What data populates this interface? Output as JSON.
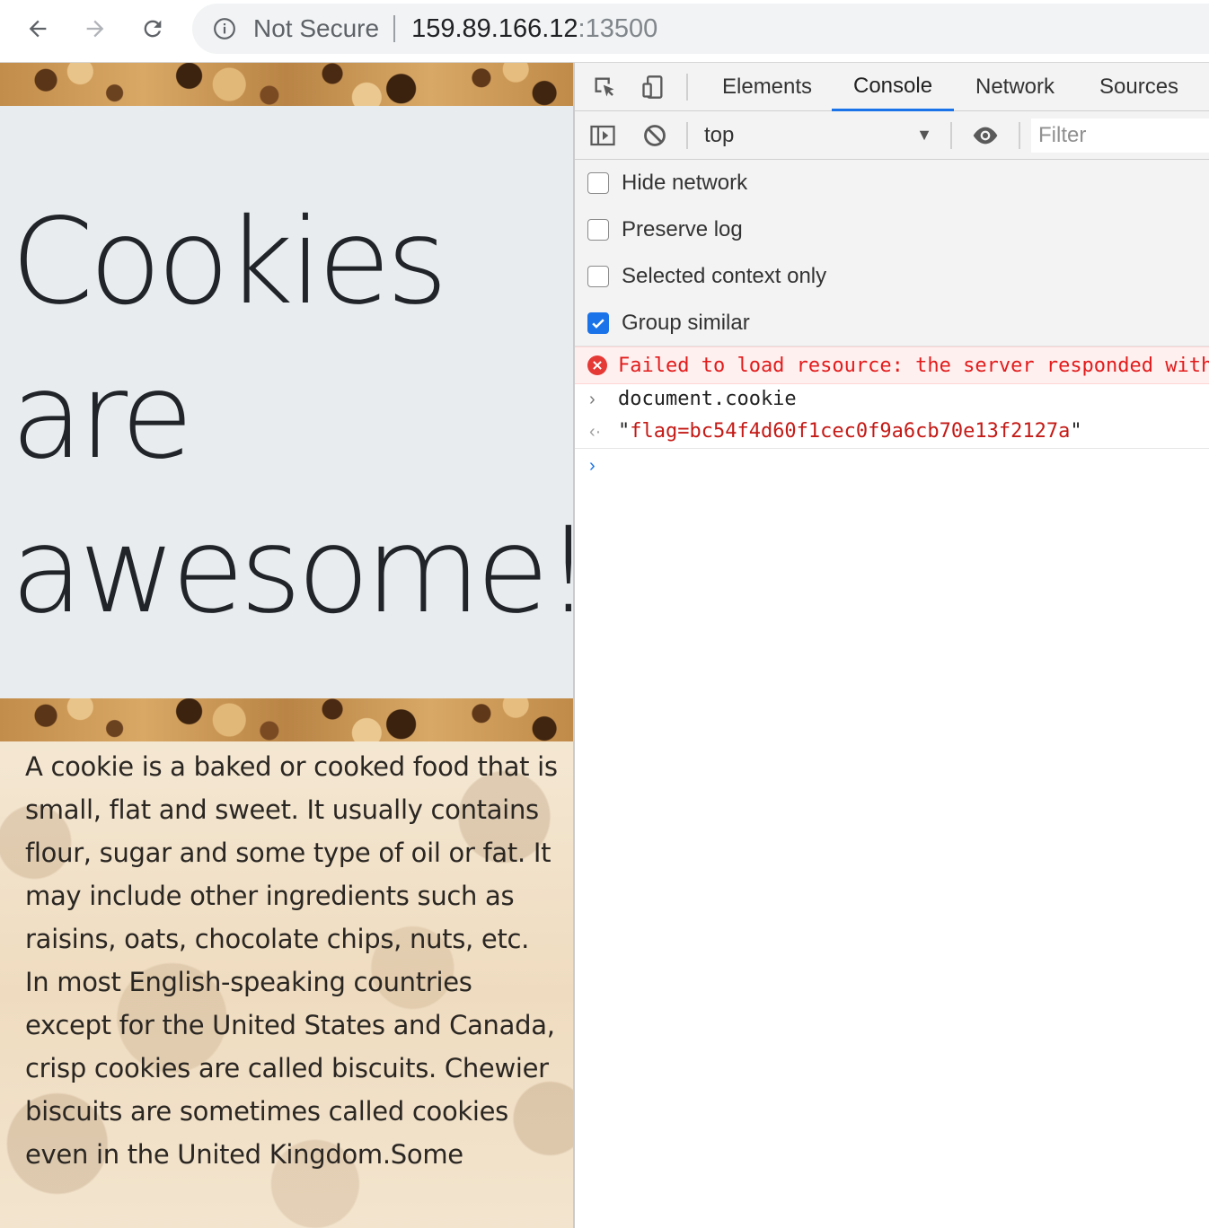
{
  "browser": {
    "security_label": "Not Secure",
    "url_host": "159.89.166.12",
    "url_port": ":13500"
  },
  "page": {
    "headline": "Cookies are awesome!",
    "body_text": "A cookie is a baked or cooked food that is small, flat and sweet. It usually contains flour, sugar and some type of oil or fat. It may include other ingredients such as raisins, oats, chocolate chips, nuts, etc. In most English-speaking countries except for the United States and Canada, crisp cookies are called biscuits. Chewier biscuits are sometimes called cookies even in the United Kingdom.Some"
  },
  "devtools": {
    "tabs": [
      "Elements",
      "Console",
      "Network",
      "Sources"
    ],
    "active_tab": "Console",
    "context": "top",
    "filter_placeholder": "Filter",
    "settings": [
      {
        "label": "Hide network",
        "checked": false
      },
      {
        "label": "Preserve log",
        "checked": false
      },
      {
        "label": "Selected context only",
        "checked": false
      },
      {
        "label": "Group similar",
        "checked": true
      }
    ],
    "console": {
      "error": "Failed to load resource: the server responded with",
      "input": "document.cookie",
      "output_quote_open": "\"",
      "output_value": "flag=bc54f4d60f1cec0f9a6cb70e13f2127a",
      "output_quote_close": "\""
    },
    "colors": {
      "accent": "#1a73e8",
      "error": "#e21b1b",
      "string": "#c41a16"
    }
  }
}
